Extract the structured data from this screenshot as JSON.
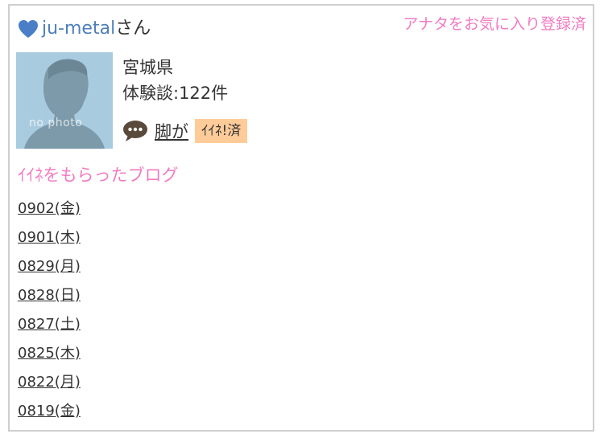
{
  "header": {
    "username": "ju-metal",
    "username_suffix": "さん",
    "favorite_status": "アナタをお気に入り登録済"
  },
  "profile": {
    "avatar_text": "no photo",
    "prefecture": "宮城県",
    "experience": "体験談:122件"
  },
  "actions": {
    "chat_label": "脚が",
    "iine_badge": "ｲｲﾈ!済"
  },
  "blog": {
    "heading": "ｲｲﾈをもらったブログ",
    "entries": [
      "0902(金)",
      "0901(木)",
      "0829(月)",
      "0828(日)",
      "0827(土)",
      "0825(木)",
      "0822(月)",
      "0819(金)"
    ]
  },
  "colors": {
    "accent_pink": "#f07cc2",
    "link_blue": "#4f7fba",
    "badge_orange": "#ffcc99"
  },
  "icons": {
    "heart": "heart-icon",
    "chat": "chat-bubble-icon"
  }
}
